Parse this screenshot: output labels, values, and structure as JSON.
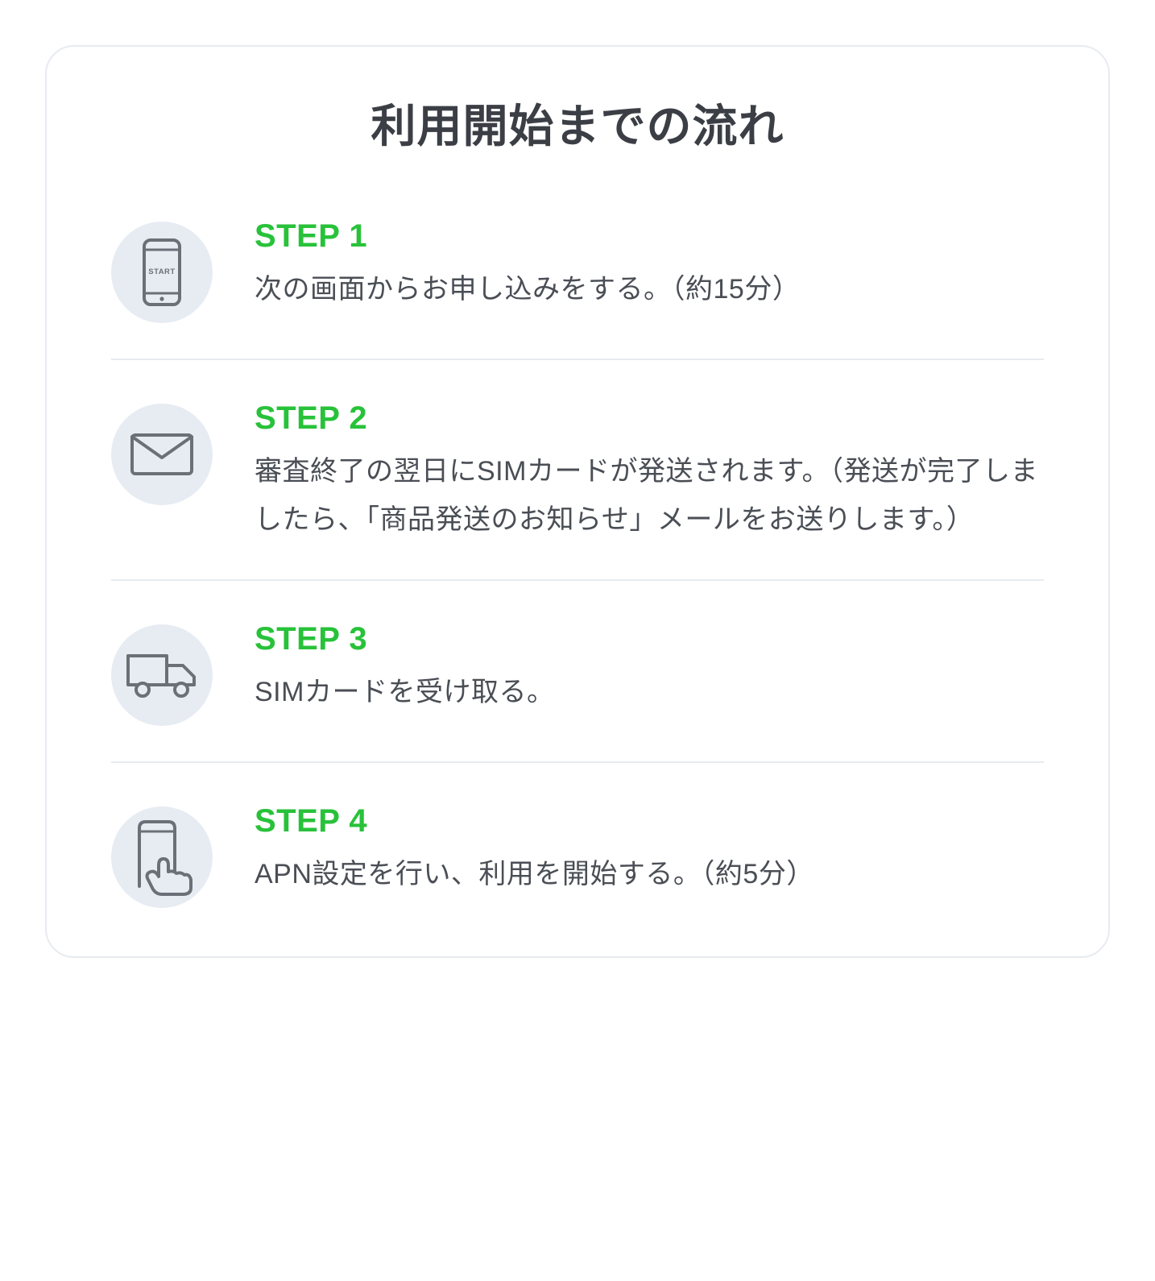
{
  "title": "利用開始までの流れ",
  "steps": [
    {
      "icon": "phone-start-icon",
      "heading": "STEP 1",
      "desc": "次の画面からお申し込みをする。（約15分）"
    },
    {
      "icon": "envelope-icon",
      "heading": "STEP 2",
      "desc": "審査終了の翌日にSIMカードが発送されます。（発送が完了しましたら、「商品発送のお知らせ」メールをお送りします。）"
    },
    {
      "icon": "truck-icon",
      "heading": "STEP 3",
      "desc": "SIMカードを受け取る。"
    },
    {
      "icon": "phone-touch-icon",
      "heading": "STEP 4",
      "desc": "APN設定を行い、利用を開始する。（約5分）"
    }
  ]
}
